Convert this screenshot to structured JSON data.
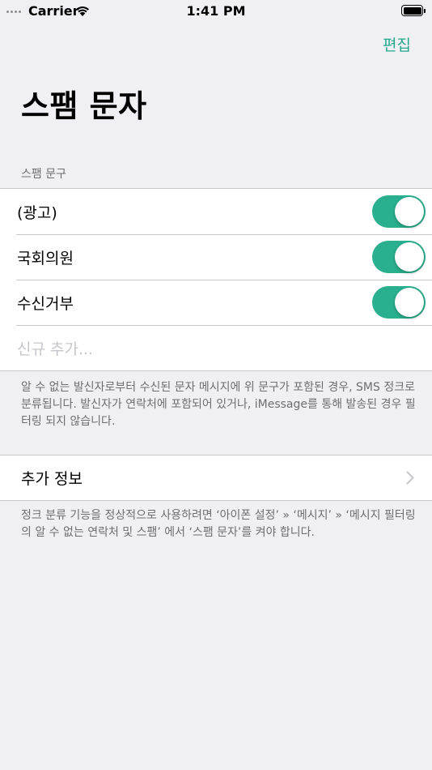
{
  "status_bar": {
    "carrier": "Carrier",
    "time": "1:41 PM"
  },
  "nav": {
    "edit_label": "편집"
  },
  "title": "스팸 문자",
  "spam_section": {
    "header": "스팸 문구",
    "items": [
      {
        "label": "(광고)",
        "enabled": true
      },
      {
        "label": "국회의원",
        "enabled": true
      },
      {
        "label": "수신거부",
        "enabled": true
      }
    ],
    "add_placeholder": "신규 추가...",
    "footer": "알 수 없는 발신자로부터 수신된 문자 메시지에 위 문구가 포함된 경우, SMS 정크로 분류됩니다. 발신자가 연락처에 포함되어 있거나, iMessage를 통해 발송된 경우 필터링 되지 않습니다."
  },
  "info_section": {
    "label": "추가 정보",
    "footer": "정크 분류 기능을 정상적으로 사용하려면 ‘아이폰 설정’ » ‘메시지’ » ‘메시지 필터링의 알 수 없는 연락처 및 스팸’ 에서 ‘스팸 문자’를 켜야 합니다."
  },
  "colors": {
    "accent": "#25a88a",
    "toggle_on": "#2bb08f",
    "background": "#efeff4"
  }
}
